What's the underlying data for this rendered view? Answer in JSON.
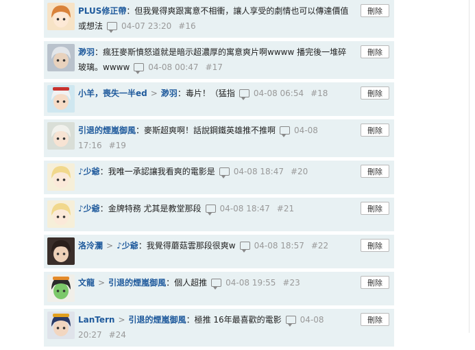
{
  "delete_label": "刪除",
  "arrow": ">",
  "colon": "：",
  "comments": [
    {
      "author": "PLUS修正帶",
      "reply_to": null,
      "text": "但我覺得爽跟寓意不相衝，讓人享受的劇情也可以傳達價值或想法",
      "time": "04-07 23:20",
      "floor": "#16",
      "avatar_icon": "anime-girl-orange-hair"
    },
    {
      "author": "渺羽",
      "reply_to": null,
      "text": "瘋狂麥斯憤怒道就是暗示超濃厚的寓意爽片啊wwww 播完後一堆碎玻璃。wwww",
      "time": "04-08 00:47",
      "floor": "#17",
      "avatar_icon": "anime-silver-hair"
    },
    {
      "author": "小羊，喪失一半ed",
      "reply_to": "渺羽",
      "text": "毒片！（猛指",
      "time": "04-08 06:54",
      "floor": "#18",
      "avatar_icon": "anime-red-white-hair"
    },
    {
      "author": "引退的煙嵐御風",
      "reply_to": null,
      "text": "麥斯超爽啊！話說鋼鐵英雄推不推啊",
      "time": "04-08 17:16",
      "floor": "#19",
      "avatar_icon": "anime-white-hair-girl"
    },
    {
      "author": "♪少爺",
      "reply_to": null,
      "text": "我唯一承認讓我看爽的電影是",
      "time": "04-08 18:47",
      "floor": "#20",
      "avatar_icon": "anime-blonde-girl"
    },
    {
      "author": "♪少爺",
      "reply_to": null,
      "text": "金牌特務 尤其是教堂那段",
      "time": "04-08 18:47",
      "floor": "#21",
      "avatar_icon": "anime-blonde-girl"
    },
    {
      "author": "洛泠瀾",
      "reply_to": "♪少爺",
      "text": "我覺得蘑菇雲那段很爽w",
      "time": "04-08 18:57",
      "floor": "#22",
      "avatar_icon": "anime-dark-hair"
    },
    {
      "author": "文龍",
      "reply_to": "引退的煙嵐御風",
      "text": "個人超推",
      "time": "04-08 19:55",
      "floor": "#23",
      "avatar_icon": "anime-cat-ears"
    },
    {
      "author": "LanTern",
      "reply_to": "引退的煙嵐御風",
      "text": "極推 16年最喜歡的電影",
      "time": "04-08 20:27",
      "floor": "#24",
      "avatar_icon": "anime-captain-hat"
    }
  ],
  "colors": {
    "accent": "#1f5a9c",
    "row_bg": "#e8f1f3",
    "meta": "#999999"
  }
}
